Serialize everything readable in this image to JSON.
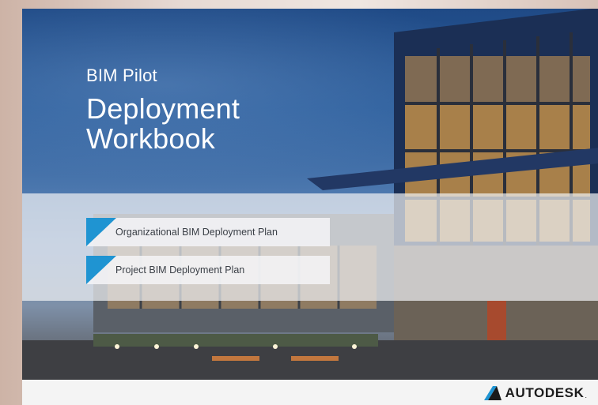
{
  "cover": {
    "subtitle": "BIM Pilot",
    "title_line1": "Deployment",
    "title_line2": "Workbook"
  },
  "menu": {
    "items": [
      {
        "label": "Organizational BIM Deployment Plan",
        "icon": "blue-triangle-icon"
      },
      {
        "label": "Project BIM Deployment Plan",
        "icon": "blue-triangle-icon"
      }
    ]
  },
  "footer": {
    "logo_text": "AUTODESK",
    "logo_mark": "."
  },
  "colors": {
    "accent": "#1f94d2",
    "sky": "#2b5d9b",
    "text_light": "#ffffff",
    "text_dark": "#3a3f46"
  }
}
